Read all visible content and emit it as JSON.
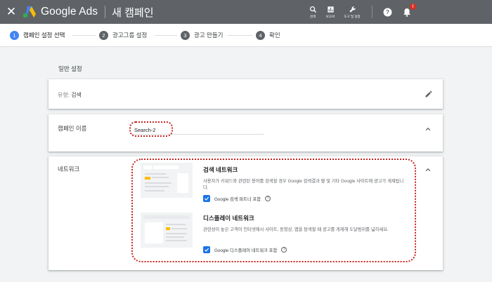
{
  "topbar": {
    "close_glyph": "✕",
    "brand": "Google Ads",
    "page_title": "새 캠페인",
    "tools": [
      {
        "icon": "search-icon",
        "label": "검색"
      },
      {
        "icon": "reports-icon",
        "label": "보고서"
      },
      {
        "icon": "wrench-icon",
        "label": "도구 및 설정"
      }
    ],
    "notification_badge": "!",
    "colors": {
      "bar": "#5f6368",
      "badge": "#d93025"
    }
  },
  "stepper": {
    "steps": [
      {
        "num": "1",
        "label": "캠페인 설정 선택",
        "active": true
      },
      {
        "num": "2",
        "label": "광고그룹 설정",
        "active": false
      },
      {
        "num": "3",
        "label": "광고 만들기",
        "active": false
      },
      {
        "num": "4",
        "label": "확인",
        "active": false
      }
    ],
    "active_color": "#4285f4"
  },
  "general": {
    "heading": "일반 설정",
    "type_label": "유형:",
    "type_value": "검색"
  },
  "campaign_name": {
    "label": "캠페인 이름",
    "value": "Search-2"
  },
  "network": {
    "label": "네트워크",
    "search": {
      "title": "검색 네트워크",
      "description": "사용자가 키워드와 관련된 용어를 검색할 경우 Google 검색결과 옆 및 기타 Google 사이트에 광고가 게재됩니다.",
      "checkbox_label": "Google 검색 파트너 포함",
      "checked": true
    },
    "display": {
      "title": "디스플레이 네트워크",
      "description": "관련성이 높은 고객이 인터넷에서 사이트, 동영상, 앱을 탐색할 때 광고를 게재해 도달범위를 넓히세요.",
      "checkbox_label": "Google 디스플레이 네트워크 포함",
      "checked": true
    },
    "help_glyph": "?"
  },
  "highlight_color": "#c5221f"
}
